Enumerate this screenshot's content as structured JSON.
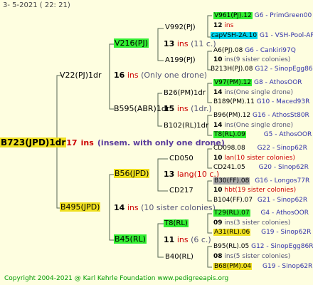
{
  "header": {
    "timestamp": "3-  5-2021 ( 22: 21)"
  },
  "copyright": "Copyright 2004-2021 @ Karl Kehrle Foundation    www.pedigreeapis.org",
  "root": {
    "name": "B723(JPD)1dr",
    "ins": "17",
    "ins_word": "ins",
    "note": "(insem. with only one drone)"
  },
  "gen1": [
    {
      "name": "V22(PJ)1dr",
      "ins": "16",
      "note": "(Only one drone)"
    },
    {
      "name": "B495(JPD)",
      "ins": "14",
      "note": "(10 sister colonies)"
    }
  ],
  "gen2": [
    {
      "name": "V216(PJ)",
      "ins": "13",
      "note": "(11 c.)"
    },
    {
      "name": "B595(ABR)1dr",
      "ins": "15",
      "note": "(1dr.)"
    },
    {
      "name": "B56(JPD)",
      "ins": "13",
      "note": "lang(10 c.)"
    },
    {
      "name": "B45(RL)",
      "ins": "11",
      "note": "(6 c.)"
    }
  ],
  "gen3": [
    {
      "name": "V992(PJ)"
    },
    {
      "name": "A199(PJ)"
    },
    {
      "name": "B26(PM)1dr"
    },
    {
      "name": "B102(RL)1dr"
    },
    {
      "name": "CD050"
    },
    {
      "name": "CD217"
    },
    {
      "name": "T8(RL)"
    },
    {
      "name": "B40(RL)"
    }
  ],
  "gen4": [
    {
      "name": "V961(PJ).12",
      "meta": "G6 - PrimGreen00"
    },
    {
      "ins": "12",
      "note": "ins"
    },
    {
      "name": "capVSH-2A.10",
      "meta": "G1 - VSH-Pool-AR"
    },
    {
      "name": "A6(PJ).08",
      "meta": "G6 - Cankiri97Q"
    },
    {
      "ins": "10",
      "note": "ins(9 sister colonies)"
    },
    {
      "name": "B213H(PJ).08",
      "meta": "G12 - SinopEgg86R"
    },
    {
      "name": "V97(PM).12",
      "meta": "G8 - AthosOOR"
    },
    {
      "ins": "14",
      "note": "ins(One single drone)"
    },
    {
      "name": "B189(PM).11",
      "meta": "G10 - Maced93R"
    },
    {
      "name": "B96(PM).12",
      "meta": "G16 - AthosSt80R"
    },
    {
      "ins": "14",
      "note": "ins(One single drone)"
    },
    {
      "name": "T8(RL).09",
      "meta": "G5 - AthosOOR"
    },
    {
      "name": "CD098.08",
      "meta": "G22 - Sinop62R"
    },
    {
      "ins": "10",
      "note": "lan(10 sister colonies)"
    },
    {
      "name": "CD241.05",
      "meta": "G20 - Sinop62R"
    },
    {
      "name": "B30(FF).08",
      "meta": "G16 - Longos77R"
    },
    {
      "ins": "10",
      "note": "hbt(19 sister colonies)"
    },
    {
      "name": "B104(FF).07",
      "meta": "G21 - Sinop62R"
    },
    {
      "name": "T29(RL).07",
      "meta": "G4 - AthosOOR"
    },
    {
      "ins": "09",
      "note": "ins(3 sister colonies)"
    },
    {
      "name": "A31(RL).06",
      "meta": "G19 - Sinop62R"
    },
    {
      "name": "B95(RL).05",
      "meta": "G12 - SinopEgg86R"
    },
    {
      "ins": "08",
      "note": "ins(5 sister colonies)"
    },
    {
      "name": "B68(PM).04",
      "meta": "G19 - Sinop62R"
    }
  ]
}
